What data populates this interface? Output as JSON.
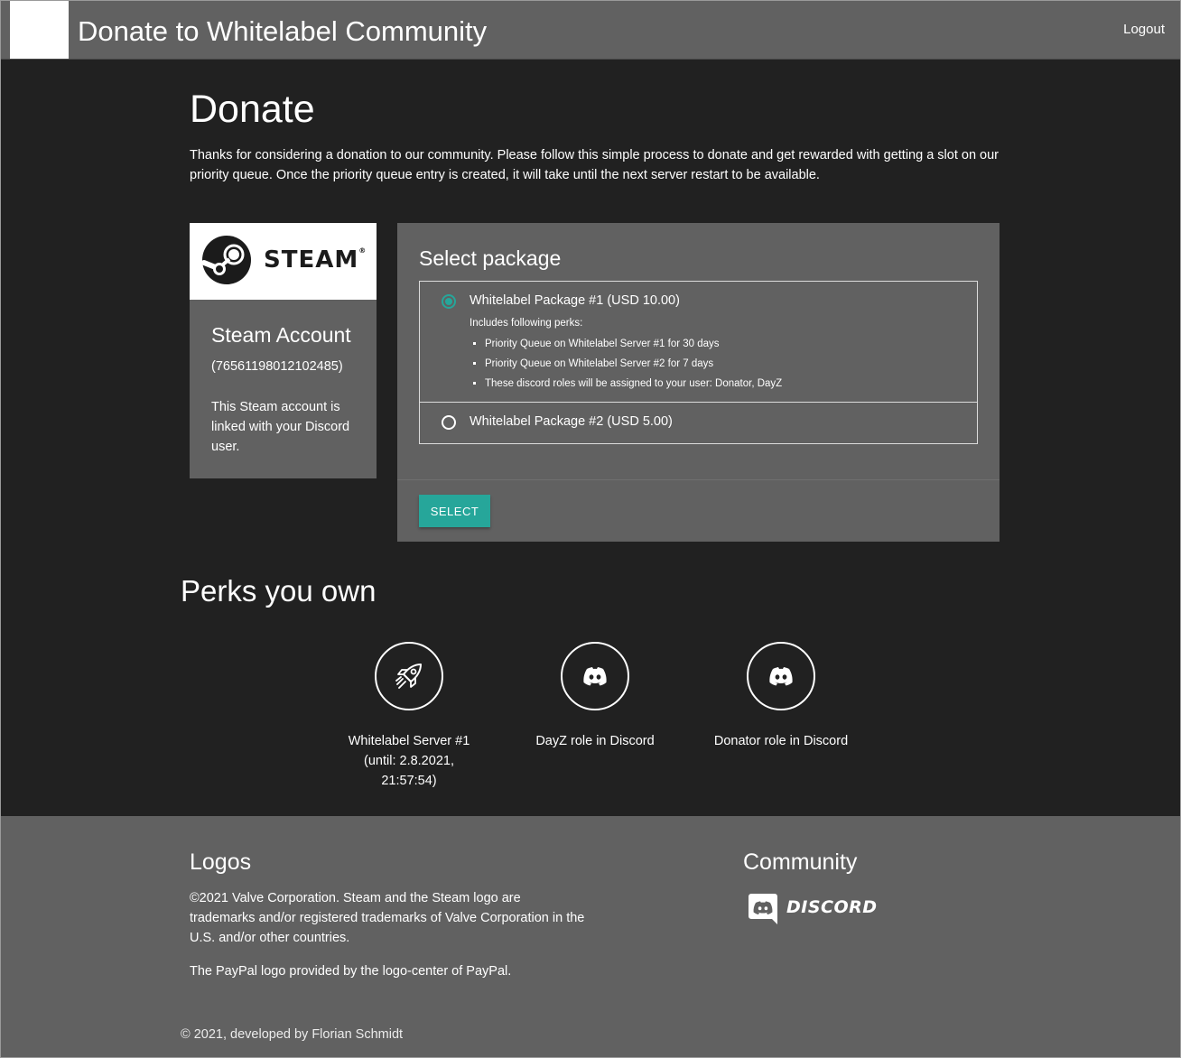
{
  "header": {
    "title": "Donate to Whitelabel Community",
    "logout_label": "Logout"
  },
  "main": {
    "title": "Donate",
    "intro": "Thanks for considering a donation to our community. Please follow this simple process to donate and get rewarded with getting a slot on our priority queue. Once the priority queue entry is created, it will take until the next server restart to be available."
  },
  "steam_card": {
    "logo_word": "STEAM",
    "title": "Steam Account",
    "account_id": "(76561198012102485)",
    "note": "This Steam account is linked with your Discord user."
  },
  "packages": {
    "title": "Select package",
    "items": [
      {
        "label": "Whitelabel Package #1 (USD 10.00)",
        "selected": true,
        "perks_intro": "Includes following perks:",
        "perks": [
          "Priority Queue on Whitelabel Server #1 for 30 days",
          "Priority Queue on Whitelabel Server #2 for 7 days",
          "These discord roles will be assigned to your user: Donator, DayZ"
        ]
      },
      {
        "label": "Whitelabel Package #2 (USD 5.00)",
        "selected": false
      }
    ],
    "select_label": "SELECT",
    "accent_color": "#26a69a"
  },
  "perks_owned": {
    "title": "Perks you own",
    "items": [
      {
        "icon": "rocket-icon",
        "label": "Whitelabel Server #1 (until: 2.8.2021, 21:57:54)"
      },
      {
        "icon": "discord-icon",
        "label": "DayZ role in Discord"
      },
      {
        "icon": "discord-icon",
        "label": "Donator role in Discord"
      }
    ]
  },
  "footer": {
    "logos_title": "Logos",
    "logos_text_1": "©2021 Valve Corporation. Steam and the Steam logo are trademarks and/or registered trademarks of Valve Corporation in the U.S. and/or other countries.",
    "logos_text_2": "The PayPal logo provided by the logo-center of PayPal.",
    "community_title": "Community",
    "discord_word": "DISCORD",
    "copyright": "© 2021, developed by Florian Schmidt"
  }
}
